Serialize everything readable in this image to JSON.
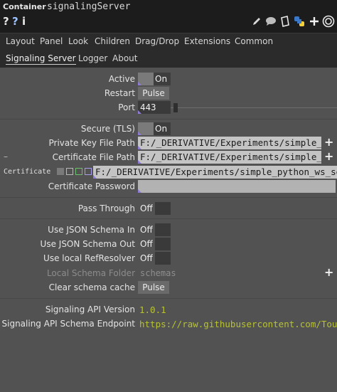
{
  "header": {
    "type": "Container",
    "name": "signalingServer"
  },
  "iconbar": {
    "help": "?",
    "python_help": "?",
    "info": "i"
  },
  "page_tabs": [
    "Layout",
    "Panel",
    "Look",
    "Children",
    "Drag/Drop",
    "Extensions",
    "Common"
  ],
  "sub_tabs": [
    "Signaling Server",
    "Logger",
    "About"
  ],
  "params": {
    "active": {
      "label": "Active",
      "value": "On"
    },
    "restart": {
      "label": "Restart",
      "button": "Pulse"
    },
    "port": {
      "label": "Port",
      "value": "443"
    },
    "secure": {
      "label": "Secure (TLS)",
      "value": "On"
    },
    "private_key": {
      "label": "Private Key File Path",
      "value": "F:/_DERIVATIVE/Experiments/simple_py"
    },
    "cert_file": {
      "label": "Certificate File Path",
      "value": "F:/_DERIVATIVE/Experiments/simple_py"
    },
    "certificate": {
      "label": "Certificate",
      "value": "F:/_DERIVATIVE/Experiments/simple_python_ws_ser"
    },
    "cert_password": {
      "label": "Certificate Password",
      "value": ""
    },
    "pass_through": {
      "label": "Pass Through",
      "value": "Off"
    },
    "json_schema_in": {
      "label": "Use JSON Schema In",
      "value": "Off"
    },
    "json_schema_out": {
      "label": "Use JSON Schema Out",
      "value": "Off"
    },
    "local_resolver": {
      "label": "Use local RefResolver",
      "value": "Off"
    },
    "local_schema_folder": {
      "label": "Local Schema Folder",
      "value": "schemas"
    },
    "clear_cache": {
      "label": "Clear schema cache",
      "button": "Pulse"
    },
    "api_version": {
      "label": "Signaling API Version",
      "value": "1.0.1"
    },
    "api_endpoint": {
      "label": "Signaling API Schema Endpoint",
      "value": "https://raw.githubusercontent.com/Touc"
    }
  },
  "colors": {
    "panel": "#525252",
    "accent_green": "#b8c234",
    "corner_purple": "#8f7ad8"
  }
}
